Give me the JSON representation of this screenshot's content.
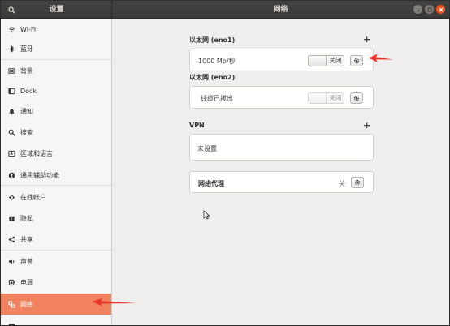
{
  "titlebar": {
    "left_title": "设置",
    "main_title": "网络"
  },
  "sidebar": {
    "items": [
      {
        "label": "Wi-Fi",
        "icon": "wifi-icon"
      },
      {
        "label": "蓝牙",
        "icon": "bluetooth-icon"
      },
      {
        "label": "背景",
        "icon": "background-icon"
      },
      {
        "label": "Dock",
        "icon": "dock-icon"
      },
      {
        "label": "通知",
        "icon": "bell-icon"
      },
      {
        "label": "搜索",
        "icon": "search-icon"
      },
      {
        "label": "区域和语言",
        "icon": "region-icon"
      },
      {
        "label": "通用辅助功能",
        "icon": "accessibility-icon"
      },
      {
        "label": "在线帐户",
        "icon": "online-accounts-icon"
      },
      {
        "label": "隐私",
        "icon": "privacy-icon"
      },
      {
        "label": "共享",
        "icon": "share-icon"
      },
      {
        "label": "声音",
        "icon": "speaker-icon"
      },
      {
        "label": "电源",
        "icon": "power-icon"
      },
      {
        "label": "网络",
        "icon": "network-icon",
        "active": true
      }
    ]
  },
  "main": {
    "eno1": {
      "title": "以太网 (eno1)",
      "status": "1000 Mb/秒",
      "switch_label": "关闭"
    },
    "eno2": {
      "title": "以太网 (eno2)",
      "status": "线缆已拔出",
      "switch_label": "关闭"
    },
    "vpn": {
      "title": "VPN",
      "status": "未设置"
    },
    "proxy": {
      "title": "网络代理",
      "value": "关"
    }
  },
  "colors": {
    "accent": "#f0825f",
    "titlebar": "#3d3c3a",
    "close": "#e95420",
    "annotation_arrow": "#e8352a"
  }
}
